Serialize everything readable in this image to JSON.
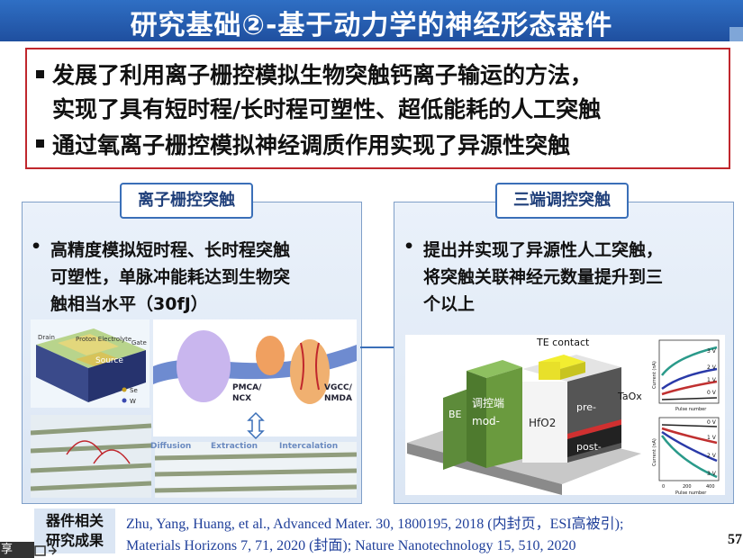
{
  "title": "研究基础②-基于动力学的神经形态器件",
  "bullets": [
    "发展了利用离子栅控模拟生物突触钙离子输运的方法，",
    "实现了具有短时程/长时程可塑性、超低能耗的人工突触",
    "通过氧离子栅控模拟神经调质作用实现了异源性突触"
  ],
  "left_panel": {
    "title": "离子栅控突触",
    "lines": [
      "高精度模拟短时程、长时程突触",
      "可塑性，单脉冲能耗达到生物突",
      "触相当水平（30fJ）"
    ],
    "figure_labels": {
      "drain": "Drain",
      "electrolyte": "Proton Electrolyte",
      "gate": "Gate",
      "source": "Source",
      "se": "Se",
      "w": "W",
      "pmca": "PMCA/",
      "ncx": "NCX",
      "vgcc": "VGCC/",
      "nmda": "NMDA",
      "diffusion": "Diffusion",
      "extraction": "Extraction",
      "intercalation": "Intercalation"
    }
  },
  "right_panel": {
    "title": "三端调控突触",
    "lines": [
      "提出并实现了异源性人工突触，",
      "将突触关联神经元数量提升到三",
      "个以上"
    ],
    "figure_labels": {
      "te": "TE contact",
      "taox": "TaOx",
      "be": "BE",
      "mod_cn": "调控端",
      "mod": "mod-",
      "hfo2": "HfO2",
      "pre": "pre-",
      "post": "post-",
      "current": "Current (nA)",
      "pulse": "Pulse number",
      "v3": "3 V",
      "v2": "2 V",
      "v1": "1 V",
      "v0": "0 V",
      "x0": "0",
      "x200": "200",
      "x400": "400"
    }
  },
  "footer": {
    "label_line1": "器件相关",
    "label_line2": "研究成果",
    "ref_line1": "Zhu, Yang, Huang, et al., Advanced Mater. 30, 1800195, 2018 (内封页，ESI高被引);",
    "ref_line2": "Materials Horizons 7, 71, 2020 (封面); Nature Nanotechnology 15, 510, 2020",
    "page_number": "57",
    "share": "享"
  }
}
